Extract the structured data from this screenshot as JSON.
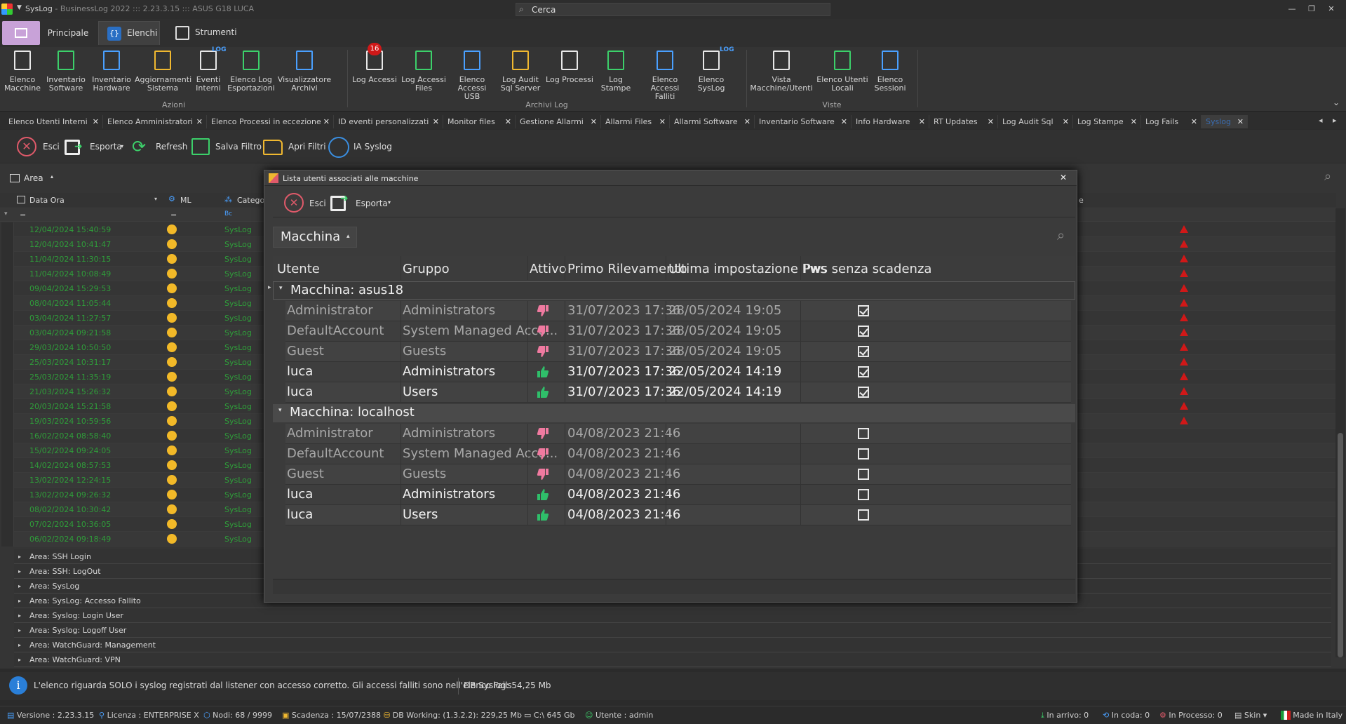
{
  "window": {
    "app_name": "SysLog",
    "app_info": "- BusinessLog 2022 ::: 2.23.3.15 ::: ASUS G18 LUCA",
    "search_placeholder": "Cerca"
  },
  "menu_tabs": [
    {
      "label": ""
    },
    {
      "label": "Principale"
    },
    {
      "label": "Elenchi"
    },
    {
      "label": "Strumenti"
    }
  ],
  "ribbon": {
    "groups": [
      "Azioni",
      "Archivi Log",
      "Viste"
    ],
    "azioni": [
      {
        "l1": "Elenco",
        "l2": "Macchine"
      },
      {
        "l1": "Inventario",
        "l2": "Software"
      },
      {
        "l1": "Inventario",
        "l2": "Hardware"
      },
      {
        "l1": "Aggiornamenti",
        "l2": "Sistema"
      },
      {
        "l1": "Eventi",
        "l2": "Interni"
      },
      {
        "l1": "Elenco Log",
        "l2": "Esportazioni"
      },
      {
        "l1": "Visualizzatore",
        "l2": "Archivi"
      }
    ],
    "archivi": [
      {
        "l1": "Log Accessi",
        "l2": ""
      },
      {
        "l1": "Log Accessi",
        "l2": "Files"
      },
      {
        "l1": "Elenco",
        "l2": "Accessi USB"
      },
      {
        "l1": "Log Audit",
        "l2": "Sql Server"
      },
      {
        "l1": "Log Processi",
        "l2": ""
      },
      {
        "l1": "Log Stampe",
        "l2": ""
      },
      {
        "l1": "Elenco Accessi",
        "l2": "Falliti"
      },
      {
        "l1": "Elenco",
        "l2": "SysLog"
      }
    ],
    "viste": [
      {
        "l1": "Vista",
        "l2": "Macchine/Utenti"
      },
      {
        "l1": "Elenco Utenti",
        "l2": "Locali"
      },
      {
        "l1": "Elenco",
        "l2": "Sessioni"
      }
    ],
    "badge": "16",
    "icon_log": "LOG"
  },
  "doc_tabs": [
    "Elenco Utenti Interni",
    "Elenco Amministratori",
    "Elenco Processi in eccezione",
    "ID eventi personalizzati",
    "Monitor files",
    "Gestione Allarmi",
    "Allarmi Files",
    "Allarmi Software",
    "Inventario Software",
    "Info Hardware",
    "RT Updates",
    "Log Audit Sql",
    "Log Stampe",
    "Log Fails",
    "Syslog"
  ],
  "toolbar": {
    "esci": "Esci",
    "esporta": "Esporta",
    "refresh": "Refresh",
    "salva_filtro": "Salva Filtro",
    "apri_filtri": "Apri Filtri",
    "ia_syslog": "IA Syslog"
  },
  "background_grid": {
    "group_chip": "Area",
    "columns": [
      "Data Ora",
      "ML",
      "Catego",
      "e"
    ],
    "rows": [
      [
        "12/04/2024 15:40:59",
        "SysLog"
      ],
      [
        "12/04/2024 10:41:47",
        "SysLog"
      ],
      [
        "11/04/2024 11:30:15",
        "SysLog"
      ],
      [
        "11/04/2024 10:08:49",
        "SysLog"
      ],
      [
        "09/04/2024 15:29:53",
        "SysLog"
      ],
      [
        "08/04/2024 11:05:44",
        "SysLog"
      ],
      [
        "03/04/2024 11:27:57",
        "SysLog"
      ],
      [
        "03/04/2024 09:21:58",
        "SysLog"
      ],
      [
        "29/03/2024 10:50:50",
        "SysLog"
      ],
      [
        "25/03/2024 10:31:17",
        "SysLog"
      ],
      [
        "25/03/2024 11:35:19",
        "SysLog"
      ],
      [
        "21/03/2024 15:26:32",
        "SysLog"
      ],
      [
        "20/03/2024 15:21:58",
        "SysLog"
      ],
      [
        "19/03/2024 10:59:56",
        "SysLog"
      ],
      [
        "16/02/2024 08:58:40",
        "SysLog"
      ],
      [
        "15/02/2024 09:24:05",
        "SysLog"
      ],
      [
        "14/02/2024 08:57:53",
        "SysLog"
      ],
      [
        "13/02/2024 12:24:15",
        "SysLog"
      ],
      [
        "13/02/2024 09:26:32",
        "SysLog"
      ],
      [
        "08/02/2024 10:30:42",
        "SysLog"
      ],
      [
        "07/02/2024 10:36:05",
        "SysLog"
      ],
      [
        "06/02/2024 09:18:49",
        "SysLog"
      ]
    ],
    "red_markers": 14,
    "area_groups": [
      "Area: SSH Login",
      "Area: SSH: LogOut",
      "Area: SysLog",
      "Area: SysLog: Accesso Fallito",
      "Area: Syslog: Login User",
      "Area: Syslog: Logoff User",
      "Area: WatchGuard: Management",
      "Area: WatchGuard: VPN"
    ]
  },
  "info": {
    "message": "L'elenco riguarda SOLO i syslog registrati dal listener con accesso corretto. Gli accessi falliti sono nell'elenco Fails",
    "db_size": "DB Syslog: 54,25 Mb"
  },
  "statusbar": {
    "versione": "Versione : 2.23.3.15",
    "licenza": "Licenza : ENTERPRISE X",
    "nodi": "Nodi: 68 / 9999",
    "scadenza": "Scadenza : 15/07/2388",
    "db": "DB Working: (1.3.2.2): 229,25 Mb",
    "disk": "C:\\ 645 Gb",
    "utente": "Utente : admin",
    "arrivo": "In arrivo: 0",
    "coda": "In coda: 0",
    "processo": "In Processo: 0",
    "skin": "Skin",
    "made": "Made in Italy"
  },
  "dialog": {
    "title": "Lista utenti associati alle macchine",
    "esci": "Esci",
    "esporta": "Esporta",
    "group_chip": "Macchina",
    "columns": [
      "Utente",
      "Gruppo",
      "Attivo",
      "Primo Rilevamento",
      "Ultima impostazione Pws",
      "Pws senza scadenza"
    ],
    "groups": [
      {
        "label": "Macchina: asus18",
        "rows": [
          {
            "utente": "Administrator",
            "gruppo": "Administrators",
            "attivo": false,
            "primo": "31/07/2023 17:36",
            "ultima": "28/05/2024 19:05",
            "noexp": true
          },
          {
            "utente": "DefaultAccount",
            "gruppo": "System Managed Acco...",
            "attivo": false,
            "primo": "31/07/2023 17:36",
            "ultima": "28/05/2024 19:05",
            "noexp": true
          },
          {
            "utente": "Guest",
            "gruppo": "Guests",
            "attivo": false,
            "primo": "31/07/2023 17:36",
            "ultima": "28/05/2024 19:05",
            "noexp": true
          },
          {
            "utente": "luca",
            "gruppo": "Administrators",
            "attivo": true,
            "primo": "31/07/2023 17:36",
            "ultima": "22/05/2024 14:19",
            "noexp": true
          },
          {
            "utente": "luca",
            "gruppo": "Users",
            "attivo": true,
            "primo": "31/07/2023 17:36",
            "ultima": "22/05/2024 14:19",
            "noexp": true
          }
        ]
      },
      {
        "label": "Macchina: localhost",
        "rows": [
          {
            "utente": "Administrator",
            "gruppo": "Administrators",
            "attivo": false,
            "primo": "04/08/2023 21:46",
            "ultima": "",
            "noexp": false
          },
          {
            "utente": "DefaultAccount",
            "gruppo": "System Managed Acco...",
            "attivo": false,
            "primo": "04/08/2023 21:46",
            "ultima": "",
            "noexp": false
          },
          {
            "utente": "Guest",
            "gruppo": "Guests",
            "attivo": false,
            "primo": "04/08/2023 21:46",
            "ultima": "",
            "noexp": false
          },
          {
            "utente": "luca",
            "gruppo": "Administrators",
            "attivo": true,
            "primo": "04/08/2023 21:46",
            "ultima": "",
            "noexp": false
          },
          {
            "utente": "luca",
            "gruppo": "Users",
            "attivo": true,
            "primo": "04/08/2023 21:46",
            "ultima": "",
            "noexp": false
          }
        ]
      }
    ]
  },
  "colors": {
    "accent_green": "#2f9e3a",
    "dot_yellow": "#f2b928",
    "marker_red": "#d01818",
    "thumb_up": "#2fbf6a",
    "thumb_down": "#f07aa0",
    "selected_tab": "#3a6cb0"
  }
}
